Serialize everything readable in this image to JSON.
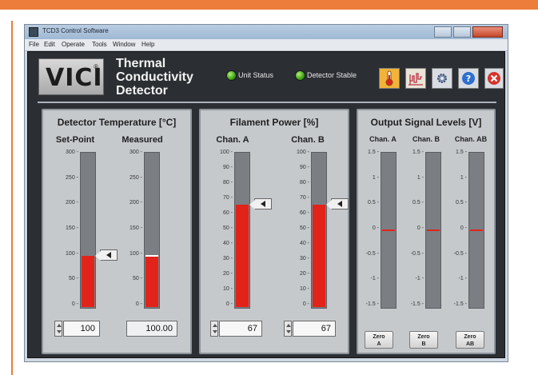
{
  "window": {
    "title": "TCD3 Control Software"
  },
  "menu": [
    "File",
    "Edit",
    "Operate",
    "Tools",
    "Window",
    "Help"
  ],
  "header": {
    "logo_text": "VICI",
    "logo_reg": "®",
    "product_title": "Thermal Conductivity Detector",
    "status_indicators": [
      {
        "label": "Unit Status",
        "color": "#3ea114"
      },
      {
        "label": "Detector Stable",
        "color": "#3ea114"
      }
    ],
    "toolbar_icons": [
      "thermometer-icon",
      "chart-icon",
      "gear-icon",
      "help-icon",
      "close-icon"
    ]
  },
  "panels": {
    "temperature": {
      "title": "Detector Temperature [°C]",
      "setpoint": {
        "label": "Set-Point",
        "value": "100",
        "level": 100,
        "scale": [
          0,
          300
        ]
      },
      "measured": {
        "label": "Measured",
        "value": "100.00",
        "level": 100,
        "scale": [
          0,
          300
        ]
      },
      "ticks": [
        "300",
        "250",
        "200",
        "150",
        "100",
        "50",
        "0"
      ]
    },
    "filament": {
      "title": "Filament Power [%]",
      "chan_a": {
        "label": "Chan. A",
        "value": "67",
        "level": 67,
        "scale": [
          0,
          100
        ]
      },
      "chan_b": {
        "label": "Chan. B",
        "value": "67",
        "level": 67,
        "scale": [
          0,
          100
        ]
      },
      "ticks": [
        "100",
        "90",
        "80",
        "70",
        "60",
        "50",
        "40",
        "30",
        "20",
        "10",
        "0"
      ]
    },
    "output": {
      "title": "Output Signal Levels [V]",
      "channels": [
        {
          "label": "Chan. A",
          "level": 0,
          "zero_label": "Zero\nA"
        },
        {
          "label": "Chan. B",
          "level": 0,
          "zero_label": "Zero\nB"
        },
        {
          "label": "Chan. AB",
          "level": 0,
          "zero_label": "Zero\nAB"
        }
      ],
      "scale": [
        -1.5,
        1.5
      ],
      "ticks": [
        "1.5",
        "1",
        "0.5",
        "0",
        "-0.5",
        "-1",
        "-1.5"
      ]
    }
  },
  "colors": {
    "fill": "#e2231a",
    "track": "#7b7f83",
    "led_green": "#3ea114",
    "orange_frame": "#ed7d3a"
  }
}
